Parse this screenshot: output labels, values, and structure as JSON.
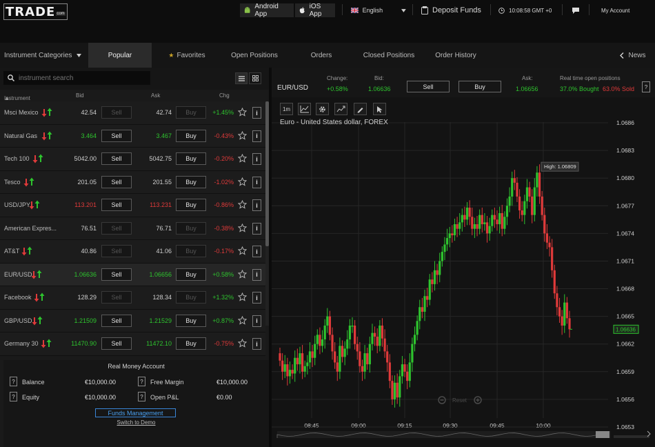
{
  "header": {
    "logo_text": "TRADE",
    "logo_suffix": "com",
    "android_label": "Android App",
    "ios_label": "iOS App",
    "language": "English",
    "deposit_label": "Deposit Funds",
    "clock": "10:08:58 GMT +0",
    "account_label": "My Account"
  },
  "nav": {
    "categories_label": "Instrument Categories",
    "tabs": [
      "Popular",
      "Favorites",
      "Open Positions",
      "Orders",
      "Closed Positions",
      "Order History"
    ],
    "active_tab": "Popular",
    "news_label": "News"
  },
  "search": {
    "placeholder": "instrument search"
  },
  "columns": {
    "instrument": "Instrument",
    "bid": "Bid",
    "ask": "Ask",
    "chg": "Chg"
  },
  "instruments": [
    {
      "name": "Msci Mexico",
      "bid": "42.54",
      "ask": "42.74",
      "sell": "Sell",
      "buy": "Buy",
      "chg": "+1.45%",
      "dir": "up",
      "active": false,
      "selected": false
    },
    {
      "name": "Natural Gas",
      "bid": "3.464",
      "ask": "3.467",
      "sell": "Sell",
      "buy": "Buy",
      "chg": "-0.43%",
      "dir": "up",
      "active": true,
      "selected": false
    },
    {
      "name": "Tech 100",
      "bid": "5042.00",
      "ask": "5042.75",
      "sell": "Sell",
      "buy": "Buy",
      "chg": "-0.20%",
      "dir": "flat",
      "active": true,
      "selected": false
    },
    {
      "name": "Tesco",
      "bid": "201.05",
      "ask": "201.55",
      "sell": "Sell",
      "buy": "Buy",
      "chg": "-1.02%",
      "dir": "flat",
      "active": true,
      "selected": false
    },
    {
      "name": "USD/JPY",
      "bid": "113.201",
      "ask": "113.231",
      "sell": "Sell",
      "buy": "Buy",
      "chg": "-0.86%",
      "dir": "down",
      "active": true,
      "selected": false
    },
    {
      "name": "American Expres...",
      "bid": "76.51",
      "ask": "76.71",
      "sell": "Sell",
      "buy": "Buy",
      "chg": "-0.38%",
      "dir": "flat",
      "active": false,
      "selected": false
    },
    {
      "name": "AT&T",
      "bid": "40.86",
      "ask": "41.06",
      "sell": "Sell",
      "buy": "Buy",
      "chg": "-0.17%",
      "dir": "flat",
      "active": false,
      "selected": false
    },
    {
      "name": "EUR/USD",
      "bid": "1.06636",
      "ask": "1.06656",
      "sell": "Sell",
      "buy": "Buy",
      "chg": "+0.58%",
      "dir": "up",
      "active": true,
      "selected": true
    },
    {
      "name": "Facebook",
      "bid": "128.29",
      "ask": "128.34",
      "sell": "Sell",
      "buy": "Buy",
      "chg": "+1.32%",
      "dir": "flat",
      "active": false,
      "selected": false
    },
    {
      "name": "GBP/USD",
      "bid": "1.21509",
      "ask": "1.21529",
      "sell": "Sell",
      "buy": "Buy",
      "chg": "+0.87%",
      "dir": "up",
      "active": true,
      "selected": false
    },
    {
      "name": "Germany 30",
      "bid": "11470.90",
      "ask": "11472.10",
      "sell": "Sell",
      "buy": "Buy",
      "chg": "-0.75%",
      "dir": "up",
      "active": true,
      "selected": false
    }
  ],
  "account": {
    "title": "Real Money Account",
    "balance_label": "Balance",
    "balance": "€10,000.00",
    "free_margin_label": "Free Margin",
    "free_margin": "€10,000.00",
    "equity_label": "Equity",
    "equity": "€10,000.00",
    "pnl_label": "Open P&L",
    "pnl": "€0.00",
    "funds_btn": "Funds Management",
    "demo_link": "Switch to Demo",
    "q": "?"
  },
  "quote": {
    "symbol": "EUR/USD",
    "change_label": "Change:",
    "change": "+0.58%",
    "bid_label": "Bid:",
    "bid": "1.06636",
    "sell": "Sell",
    "buy": "Buy",
    "ask_label": "Ask:",
    "ask": "1.06656",
    "positions_label": "Real time open positions",
    "bought": "37.0% Bought",
    "sold": "63.0% Sold",
    "help": "?"
  },
  "chart": {
    "timeframe": "1m",
    "title": "Euro - United States dollar, FOREX",
    "high_label": "High: 1.06809",
    "last_price": "1.06636",
    "reset_label": "Reset",
    "colors": {
      "up": "#2ec42e",
      "down": "#e03a3a",
      "bg": "#131313",
      "grid": "#262626"
    }
  },
  "chart_data": {
    "type": "candlestick",
    "y_ticks": [
      "1.0686",
      "1.0683",
      "1.0680",
      "1.0677",
      "1.0674",
      "1.0671",
      "1.0668",
      "1.0665",
      "1.0662",
      "1.0659",
      "1.0656",
      "1.0653"
    ],
    "x_ticks": [
      "08:45",
      "09:00",
      "09:15",
      "09:30",
      "09:45",
      "10:00"
    ],
    "ylim": [
      1.06515,
      1.06875
    ],
    "closes": [
      1.06602,
      1.0659,
      1.06598,
      1.06585,
      1.06592,
      1.06588,
      1.06605,
      1.06598,
      1.0661,
      1.0659,
      1.06596,
      1.066,
      1.06612,
      1.06605,
      1.0662,
      1.0663,
      1.06618,
      1.06625,
      1.0664,
      1.0665,
      1.0663,
      1.06612,
      1.066,
      1.0659,
      1.06618,
      1.06606,
      1.06615,
      1.06625,
      1.0664,
      1.0664,
      1.0662,
      1.06612,
      1.06596,
      1.0659,
      1.0661,
      1.06598,
      1.0662,
      1.06632,
      1.06628,
      1.06618,
      1.0664,
      1.06626,
      1.06612,
      1.066,
      1.0658,
      1.0656,
      1.06578,
      1.06562,
      1.06585,
      1.06598,
      1.0659,
      1.0658,
      1.066,
      1.0662,
      1.0663,
      1.06645,
      1.0666,
      1.06655,
      1.06672,
      1.06668,
      1.0669,
      1.06685,
      1.067,
      1.06695,
      1.0671,
      1.0672,
      1.06728,
      1.06735,
      1.0674,
      1.06738,
      1.0675,
      1.06745,
      1.06752,
      1.0676,
      1.06755,
      1.06768,
      1.06758,
      1.06745,
      1.0675,
      1.06745,
      1.0676,
      1.0675,
      1.06752,
      1.0674,
      1.06748,
      1.0676,
      1.06755,
      1.0675,
      1.06762,
      1.06745,
      1.06758,
      1.0677,
      1.0678,
      1.068,
      1.06795,
      1.0678,
      1.06765,
      1.0676,
      1.06775,
      1.0679,
      1.0678,
      1.0676,
      1.0679,
      1.06806,
      1.0678,
      1.0676,
      1.0674,
      1.0673,
      1.06725,
      1.067,
      1.06675,
      1.0666,
      1.0665,
      1.0664,
      1.06665,
      1.06648,
      1.06636
    ]
  }
}
